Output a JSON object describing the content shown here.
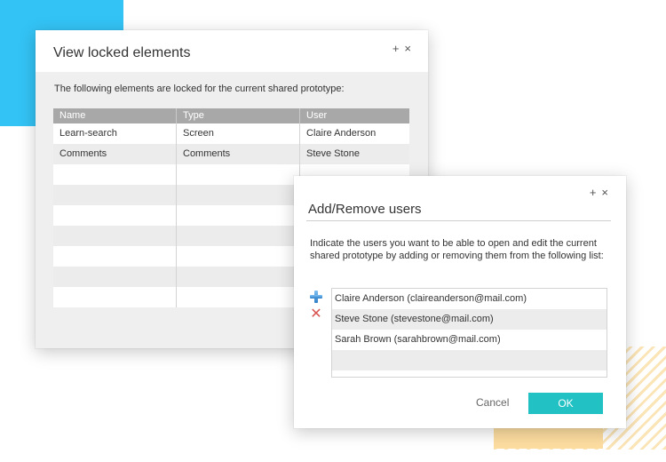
{
  "colors": {
    "accent": "#22c1c3",
    "corner_blue": "#33c3f5",
    "stripes": "#fbe4b5",
    "remove": "#d9534f",
    "add": "#3c8fd6"
  },
  "locked_dialog": {
    "title": "View locked elements",
    "maximize": "+",
    "close": "×",
    "description": "The following elements are locked for the current shared prototype:",
    "columns": [
      "Name",
      "Type",
      "User"
    ],
    "rows": [
      [
        "Learn-search",
        "Screen",
        "Claire Anderson"
      ],
      [
        "Comments",
        "Comments",
        "Steve Stone"
      ]
    ]
  },
  "users_dialog": {
    "title": "Add/Remove users",
    "maximize": "+",
    "close": "×",
    "description": "Indicate the users you want to be able to open and edit the current shared prototype by adding or removing them from the following list:",
    "add_icon": "plus-icon",
    "remove_icon": "x-icon",
    "users": [
      "Claire Anderson (claireanderson@mail.com)",
      "Steve Stone (stevestone@mail.com)",
      "Sarah Brown (sarahbrown@mail.com)"
    ],
    "cancel_label": "Cancel",
    "ok_label": "OK"
  }
}
